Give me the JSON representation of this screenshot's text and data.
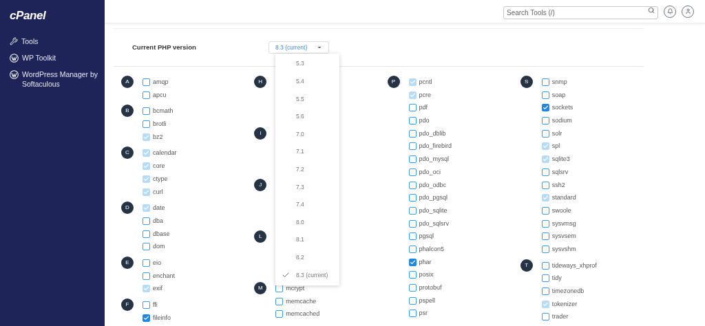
{
  "sidebar": {
    "logo": "cPanel",
    "items": [
      {
        "label": "Tools",
        "kind": "tools"
      },
      {
        "label": "WP Toolkit",
        "kind": "wordpress"
      },
      {
        "label": "WordPress Manager by Softaculous",
        "kind": "wordpress"
      }
    ]
  },
  "header": {
    "search": {
      "placeholder": "Search Tools (/)"
    }
  },
  "php_version": {
    "label": "Current PHP version",
    "value": "8.3 (current)",
    "options": [
      {
        "label": "5.3",
        "selected": false
      },
      {
        "label": "5.4",
        "selected": false
      },
      {
        "label": "5.5",
        "selected": false
      },
      {
        "label": "5.6",
        "selected": false
      },
      {
        "label": "7.0",
        "selected": false
      },
      {
        "label": "7.1",
        "selected": false
      },
      {
        "label": "7.2",
        "selected": false
      },
      {
        "label": "7.3",
        "selected": false
      },
      {
        "label": "7.4",
        "selected": false
      },
      {
        "label": "8.0",
        "selected": false
      },
      {
        "label": "8.1",
        "selected": false
      },
      {
        "label": "8.2",
        "selected": false
      },
      {
        "label": "8.3 (current)",
        "selected": true
      }
    ]
  },
  "columns": [
    [
      {
        "letter": "A",
        "items": [
          {
            "label": "amqp",
            "checked": false,
            "disabled": false
          },
          {
            "label": "apcu",
            "checked": false,
            "disabled": false
          }
        ]
      },
      {
        "letter": "B",
        "items": [
          {
            "label": "bcmath",
            "checked": false,
            "disabled": false
          },
          {
            "label": "brotli",
            "checked": false,
            "disabled": false
          },
          {
            "label": "bz2",
            "checked": true,
            "disabled": true
          }
        ]
      },
      {
        "letter": "C",
        "items": [
          {
            "label": "calendar",
            "checked": true,
            "disabled": true
          },
          {
            "label": "core",
            "checked": true,
            "disabled": true
          },
          {
            "label": "ctype",
            "checked": true,
            "disabled": true
          },
          {
            "label": "curl",
            "checked": true,
            "disabled": true
          }
        ]
      },
      {
        "letter": "D",
        "items": [
          {
            "label": "date",
            "checked": true,
            "disabled": true
          },
          {
            "label": "dba",
            "checked": false,
            "disabled": false
          },
          {
            "label": "dbase",
            "checked": false,
            "disabled": false
          },
          {
            "label": "dom",
            "checked": false,
            "disabled": false
          }
        ]
      },
      {
        "letter": "E",
        "items": [
          {
            "label": "eio",
            "checked": false,
            "disabled": false
          },
          {
            "label": "enchant",
            "checked": false,
            "disabled": false
          },
          {
            "label": "exif",
            "checked": true,
            "disabled": true
          }
        ]
      },
      {
        "letter": "F",
        "items": [
          {
            "label": "ffi",
            "checked": false,
            "disabled": false
          },
          {
            "label": "fileinfo",
            "checked": true,
            "disabled": false
          }
        ]
      }
    ],
    [
      {
        "letter": "H"
      },
      {
        "letter": "I"
      },
      {
        "letter": "J"
      },
      {
        "letter": "L"
      },
      {
        "letter": "M",
        "items": [
          {
            "label": "mcrypt",
            "checked": false,
            "disabled": false
          },
          {
            "label": "memcache",
            "checked": false,
            "disabled": false
          },
          {
            "label": "memcached",
            "checked": false,
            "disabled": false
          }
        ]
      }
    ],
    [
      {
        "letter": "P",
        "items": [
          {
            "label": "pcntl",
            "checked": true,
            "disabled": true
          },
          {
            "label": "pcre",
            "checked": true,
            "disabled": true
          },
          {
            "label": "pdf",
            "checked": false,
            "disabled": false
          },
          {
            "label": "pdo",
            "checked": false,
            "disabled": false
          },
          {
            "label": "pdo_dblib",
            "checked": false,
            "disabled": false
          },
          {
            "label": "pdo_firebird",
            "checked": false,
            "disabled": false
          },
          {
            "label": "pdo_mysql",
            "checked": false,
            "disabled": false
          },
          {
            "label": "pdo_oci",
            "checked": false,
            "disabled": false
          },
          {
            "label": "pdo_odbc",
            "checked": false,
            "disabled": false
          },
          {
            "label": "pdo_pgsql",
            "checked": false,
            "disabled": false
          },
          {
            "label": "pdo_sqlite",
            "checked": false,
            "disabled": false
          },
          {
            "label": "pdo_sqlsrv",
            "checked": false,
            "disabled": false
          },
          {
            "label": "pgsql",
            "checked": false,
            "disabled": false
          },
          {
            "label": "phalcon5",
            "checked": false,
            "disabled": false
          },
          {
            "label": "phar",
            "checked": true,
            "disabled": false
          },
          {
            "label": "posix",
            "checked": false,
            "disabled": false
          },
          {
            "label": "protobuf",
            "checked": false,
            "disabled": false
          },
          {
            "label": "pspell",
            "checked": false,
            "disabled": false
          },
          {
            "label": "psr",
            "checked": false,
            "disabled": false
          }
        ]
      }
    ],
    [
      {
        "letter": "S",
        "items": [
          {
            "label": "snmp",
            "checked": false,
            "disabled": false
          },
          {
            "label": "soap",
            "checked": false,
            "disabled": false
          },
          {
            "label": "sockets",
            "checked": true,
            "disabled": false
          },
          {
            "label": "sodium",
            "checked": false,
            "disabled": false
          },
          {
            "label": "solr",
            "checked": false,
            "disabled": false
          },
          {
            "label": "spl",
            "checked": true,
            "disabled": true
          },
          {
            "label": "sqlite3",
            "checked": true,
            "disabled": true
          },
          {
            "label": "sqlsrv",
            "checked": false,
            "disabled": false
          },
          {
            "label": "ssh2",
            "checked": false,
            "disabled": false
          },
          {
            "label": "standard",
            "checked": true,
            "disabled": true
          },
          {
            "label": "swoole",
            "checked": false,
            "disabled": false
          },
          {
            "label": "sysvmsg",
            "checked": false,
            "disabled": false
          },
          {
            "label": "sysvsem",
            "checked": false,
            "disabled": false
          },
          {
            "label": "sysvshm",
            "checked": false,
            "disabled": false
          }
        ]
      },
      {
        "letter": "T",
        "items": [
          {
            "label": "tideways_xhprof",
            "checked": false,
            "disabled": false
          },
          {
            "label": "tidy",
            "checked": false,
            "disabled": false
          },
          {
            "label": "timezonedb",
            "checked": false,
            "disabled": false
          },
          {
            "label": "tokenizer",
            "checked": true,
            "disabled": true
          },
          {
            "label": "trader",
            "checked": false,
            "disabled": false
          }
        ]
      }
    ]
  ]
}
